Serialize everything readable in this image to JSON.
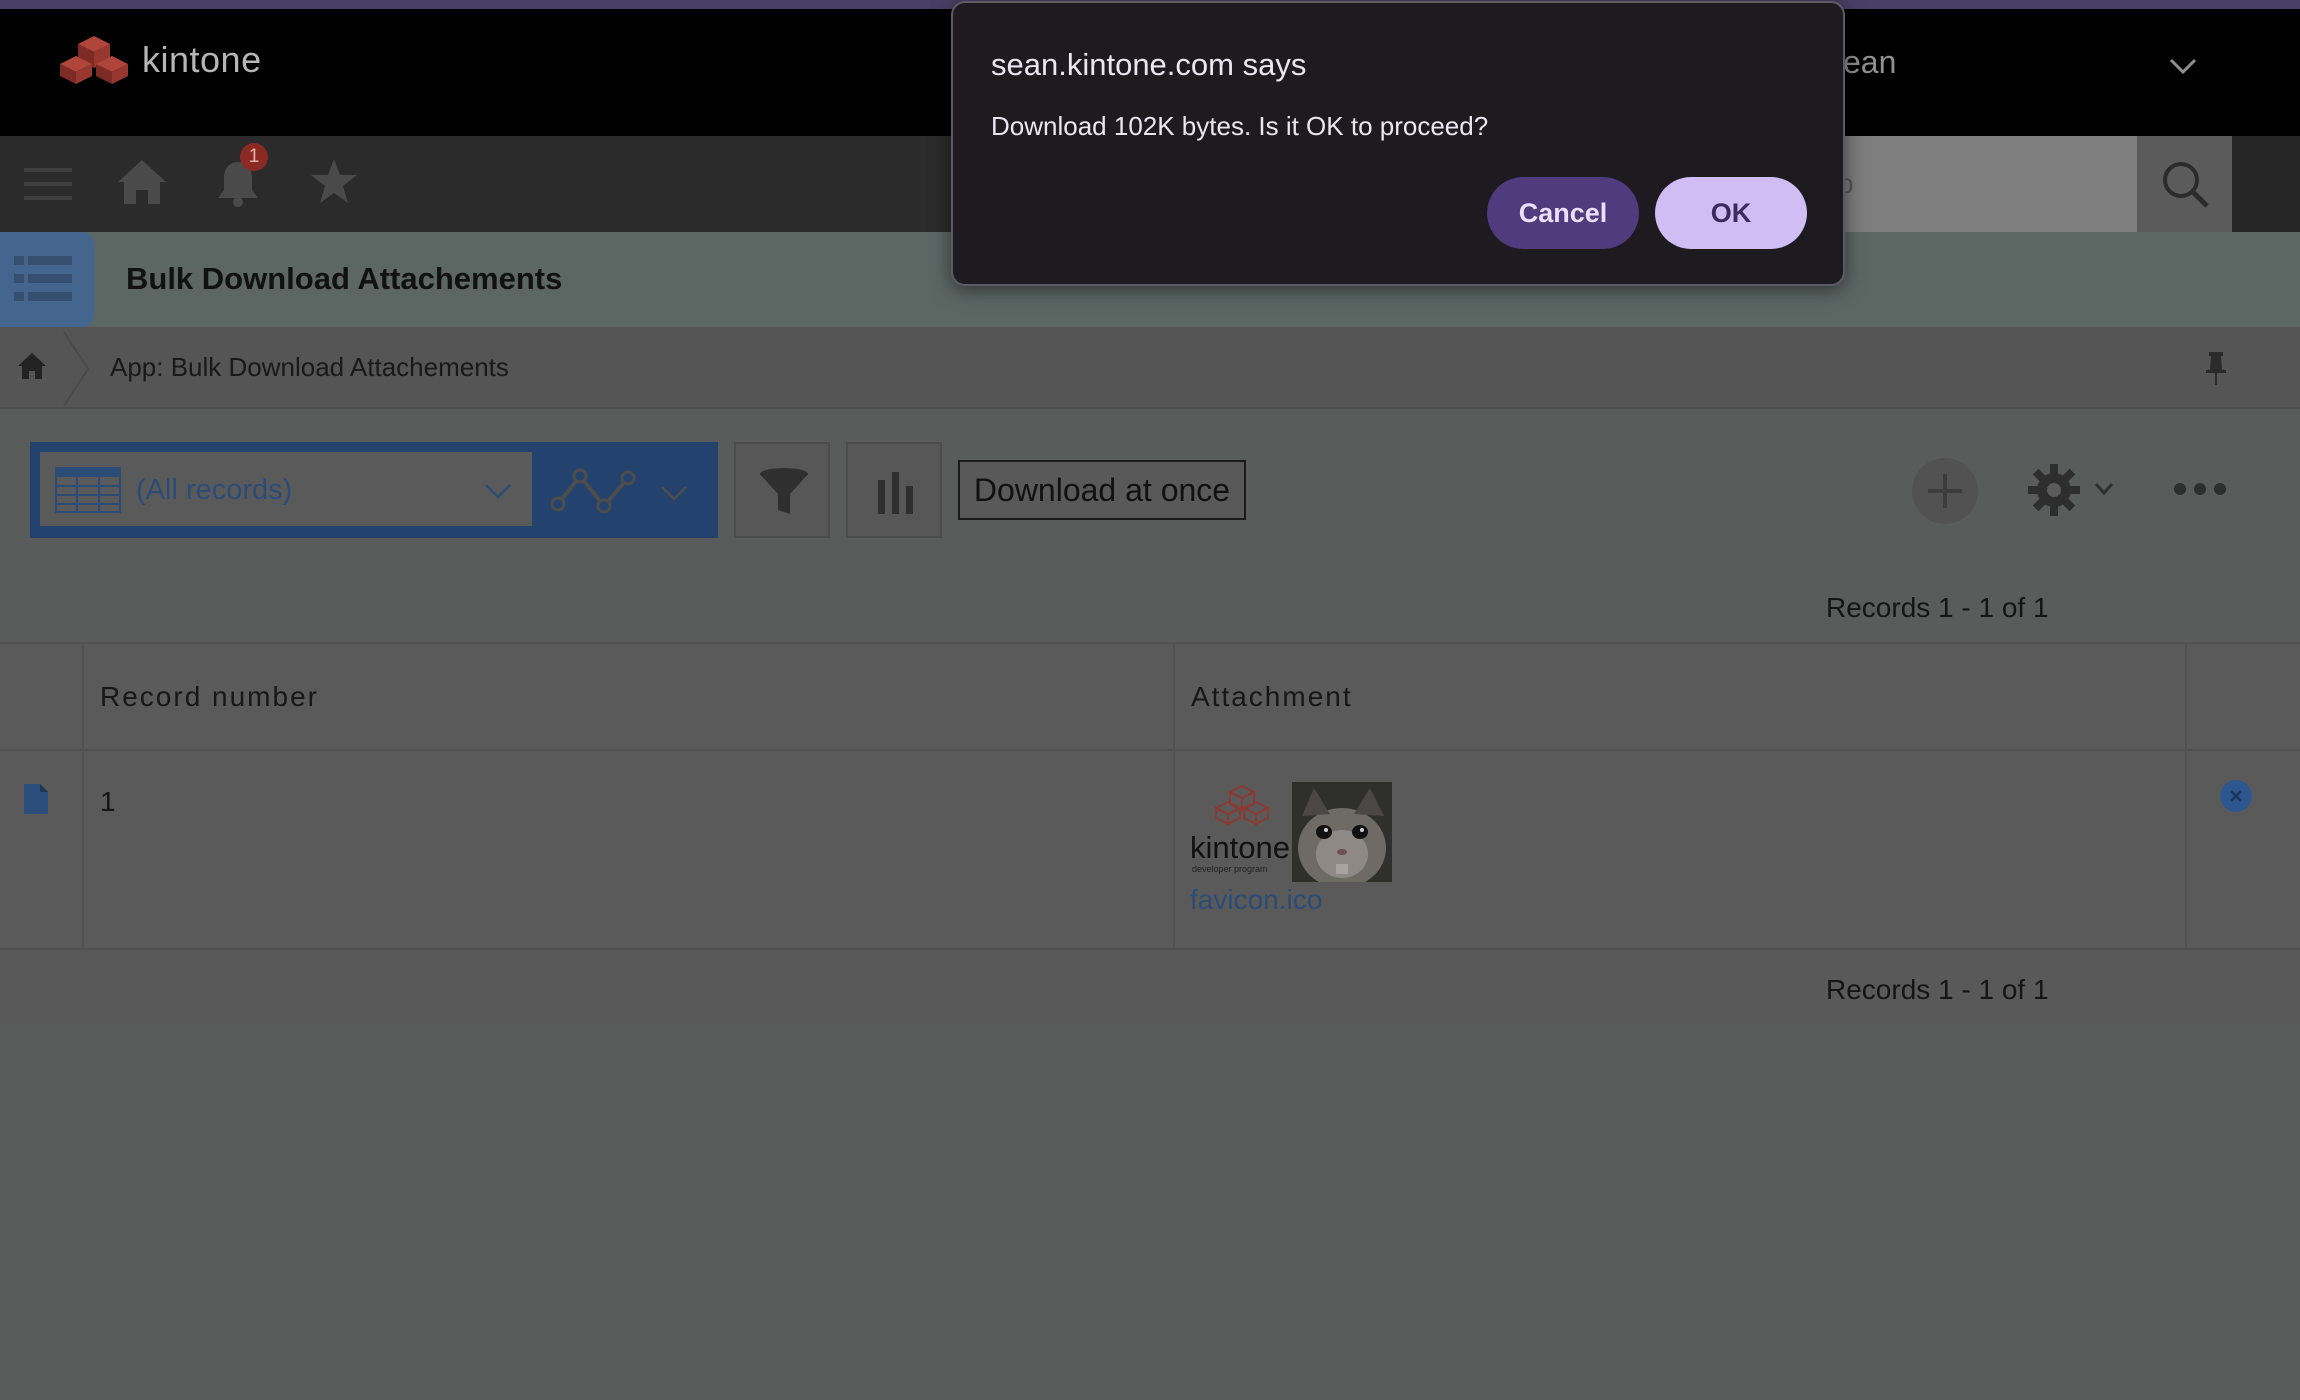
{
  "header": {
    "logo_text": "kintone",
    "user_name": "ean",
    "user_menu_icon": "chevron-down-icon"
  },
  "nav": {
    "icons": [
      "hamburger-menu-icon",
      "home-icon",
      "bell-icon",
      "star-icon"
    ],
    "notification_count": "1",
    "search_placeholder": "p",
    "search_icon": "search-icon"
  },
  "app": {
    "title": "Bulk Download Attachements",
    "breadcrumb": "App: Bulk Download Attachements"
  },
  "toolbar": {
    "view_label": "(All records)",
    "download_label": "Download at once"
  },
  "table": {
    "records_count": "Records 1 - 1 of 1",
    "columns": [
      "Record number",
      "Attachment"
    ],
    "rows": [
      {
        "record_number": "1",
        "attachment_filename": "favicon.ico"
      }
    ]
  },
  "thumbnail": {
    "logo_text": "kintone",
    "logo_subtext": "developer program"
  },
  "dialog": {
    "title": "sean.kintone.com says",
    "message": "Download 102K bytes. Is it OK to proceed?",
    "cancel_label": "Cancel",
    "ok_label": "OK",
    "ok_color": "#cfbdf3",
    "cancel_color": "#4f3b7d"
  }
}
